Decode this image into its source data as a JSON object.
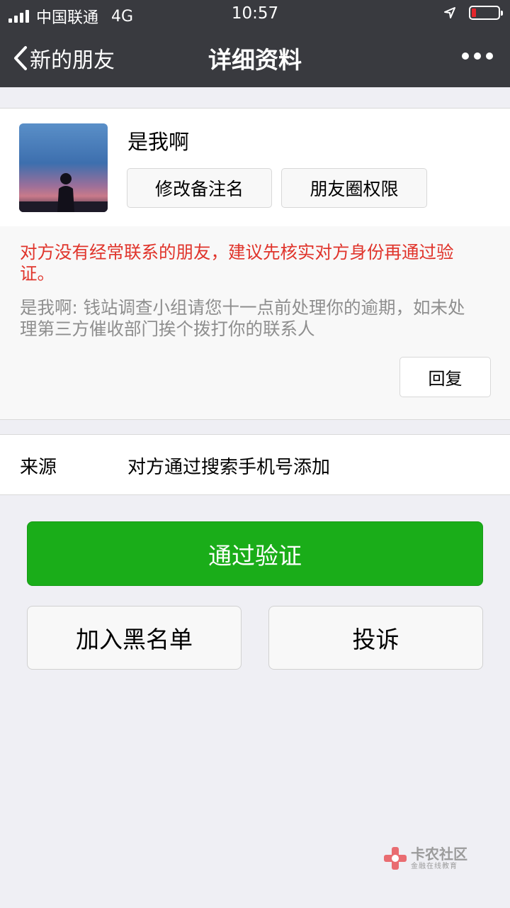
{
  "status_bar": {
    "carrier": "中国联通",
    "network": "4G",
    "time": "10:57",
    "battery_color": "#e4262c"
  },
  "nav": {
    "back_label": "新的朋友",
    "title": "详细资料",
    "back_icon": "chevron-left-icon",
    "more_icon": "more-dots-icon"
  },
  "profile": {
    "name": "是我啊",
    "remark_button": "修改备注名",
    "moments_button": "朋友圈权限"
  },
  "verification": {
    "warning": "对方没有经常联系的朋友，建议先核实对方身份再通过验证。",
    "message": "是我啊: 钱站调查小组请您十一点前处理你的逾期，如未处理第三方催收部门挨个拨打你的联系人",
    "reply_button": "回复",
    "warning_color": "#e0342b"
  },
  "source": {
    "label": "来源",
    "value": "对方通过搜索手机号添加"
  },
  "actions": {
    "accept": "通过验证",
    "blacklist": "加入黑名单",
    "report": "投诉",
    "accept_color": "#1aad19"
  },
  "watermark": {
    "name": "卡农社区",
    "tagline": "金融在线教育"
  }
}
